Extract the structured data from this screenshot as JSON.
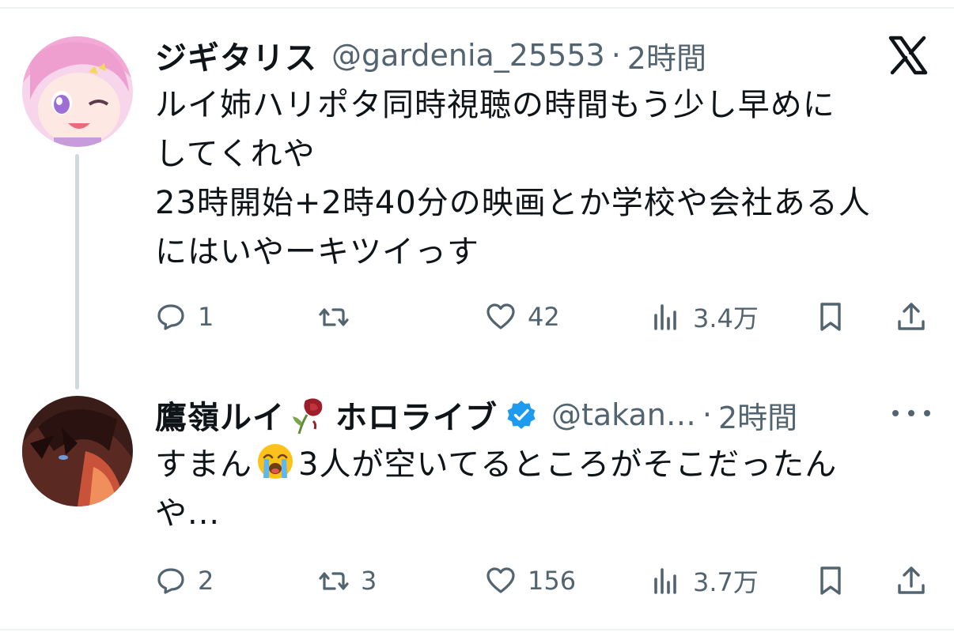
{
  "tweets": [
    {
      "author_name": "ジギタリス",
      "handle": "@gardenia_25553",
      "separator": "·",
      "time": "2時間",
      "text": "ルイ姉ハリポタ同時視聴の時間もう少し早めに\nしてくれや\n23時開始+2時40分の映画とか学校や会社ある人\nにはいやーキツイっす",
      "replies": "1",
      "retweets": "",
      "likes": "42",
      "views": "3.4万",
      "corner_icon": "x-logo-icon"
    },
    {
      "author_name_part1": "鷹嶺ルイ",
      "author_name_part2": "ホロライブ",
      "name_emoji": "wilted-rose-icon",
      "verified": true,
      "handle": "@takan…",
      "separator": "·",
      "time": "2時間",
      "text_before_emoji": "すまん",
      "text_emoji": "loudly-crying-face-icon",
      "text_after_emoji": "3人が空いてるところがそこだったん\nや...",
      "replies": "2",
      "retweets": "3",
      "likes": "156",
      "views": "3.7万",
      "corner_icon": "more-options-icon"
    }
  ],
  "colors": {
    "text": "#0f1419",
    "muted": "#536471",
    "verified": "#1d9bf0",
    "divider": "#eff3f4",
    "thread_line": "#cfd9de"
  }
}
